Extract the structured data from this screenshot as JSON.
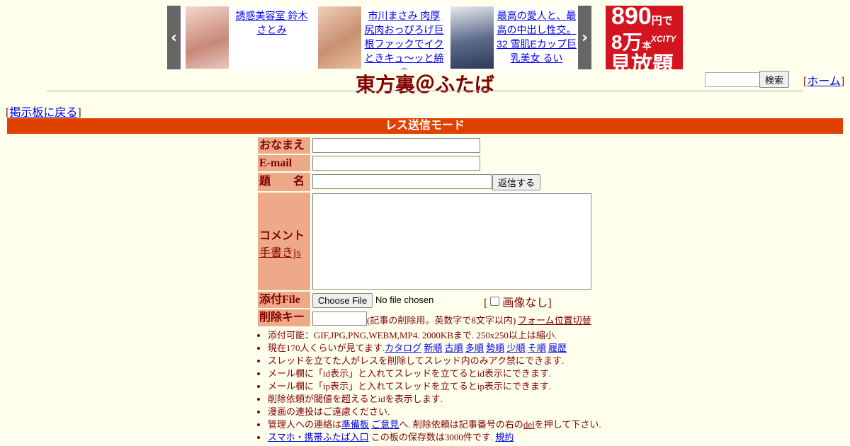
{
  "ads": {
    "prev_arrow": "‹",
    "next_arrow": "›",
    "items": [
      {
        "text": "誘惑美容室 鈴木さとみ",
        "thumb_color": "#d8a898"
      },
      {
        "text": "市川まさみ 肉厚尻肉おっぴろげ巨根ファックでイクときキュ～ッと締ま",
        "thumb_color": "#e0b898"
      },
      {
        "text": "最高の愛人と、最高の中出し性交。32 雪肌Eカップ巨乳美女 るい",
        "thumb_color": "#7a8aa0"
      }
    ],
    "banner": {
      "price": "890",
      "price_unit": "円で",
      "count": "8万",
      "count_unit": "本",
      "brand": "XCITY",
      "tagline": "見放題"
    }
  },
  "header": {
    "title": "東方裏＠ふたば",
    "search_button": "検索",
    "home_bracket_open": "[",
    "home_label": "ホーム",
    "home_bracket_close": "]"
  },
  "nav": {
    "back_open": "[",
    "back_label": "掲示板に戻る",
    "back_close": "]"
  },
  "mode_bar": "レス送信モード",
  "form": {
    "name_label": "おなまえ",
    "email_label": "E-mail",
    "subject_label": "題　　名",
    "submit_label": "返信する",
    "comment_label": "コメント",
    "tegaki_link": "手書きjs",
    "file_label": "添付File",
    "choose_file": "Choose File",
    "no_file": "No file chosen",
    "noimage_open": "[",
    "noimage_label": "画像なし",
    "noimage_close": "]",
    "delkey_label": "削除キー",
    "delkey_note": "(記事の削除用。英数字で8文字以内)",
    "toggle_link": "フォーム位置切替"
  },
  "rules": {
    "r1": "添付可能：GIF,JPG,PNG,WEBM,MP4. 2000KBまで. 250x250以上は縮小.",
    "r2_prefix": "現在170人くらいが見てます.",
    "r2_links": [
      "カタログ",
      "新順",
      "古順",
      "多順",
      "勢順",
      "少順",
      "そ順",
      "履歴"
    ],
    "r3": "スレッドを立てた人がレスを削除してスレッド内のみアク禁にできます.",
    "r4": "メール欄に「id表示」と入れてスレッドを立てるとid表示にできます.",
    "r5": "メール欄に「ip表示」と入れてスレッドを立てるとip表示にできます.",
    "r6": "削除依頼が閾値を超えるとidを表示します.",
    "r7": "漫画の連投はご遠慮ください.",
    "r8_prefix": "管理人への連絡は",
    "r8_link1": "準備板",
    "r8_link2": "ご意見",
    "r8_mid": "へ. 削除依頼は記事番号の右の",
    "r8_del": "del",
    "r8_suffix": "を押して下さい.",
    "r9_link": "スマホ・携帯ふたば入口",
    "r9_mid": "この板の保存数は3000件です.",
    "r9_link2": "規約"
  }
}
